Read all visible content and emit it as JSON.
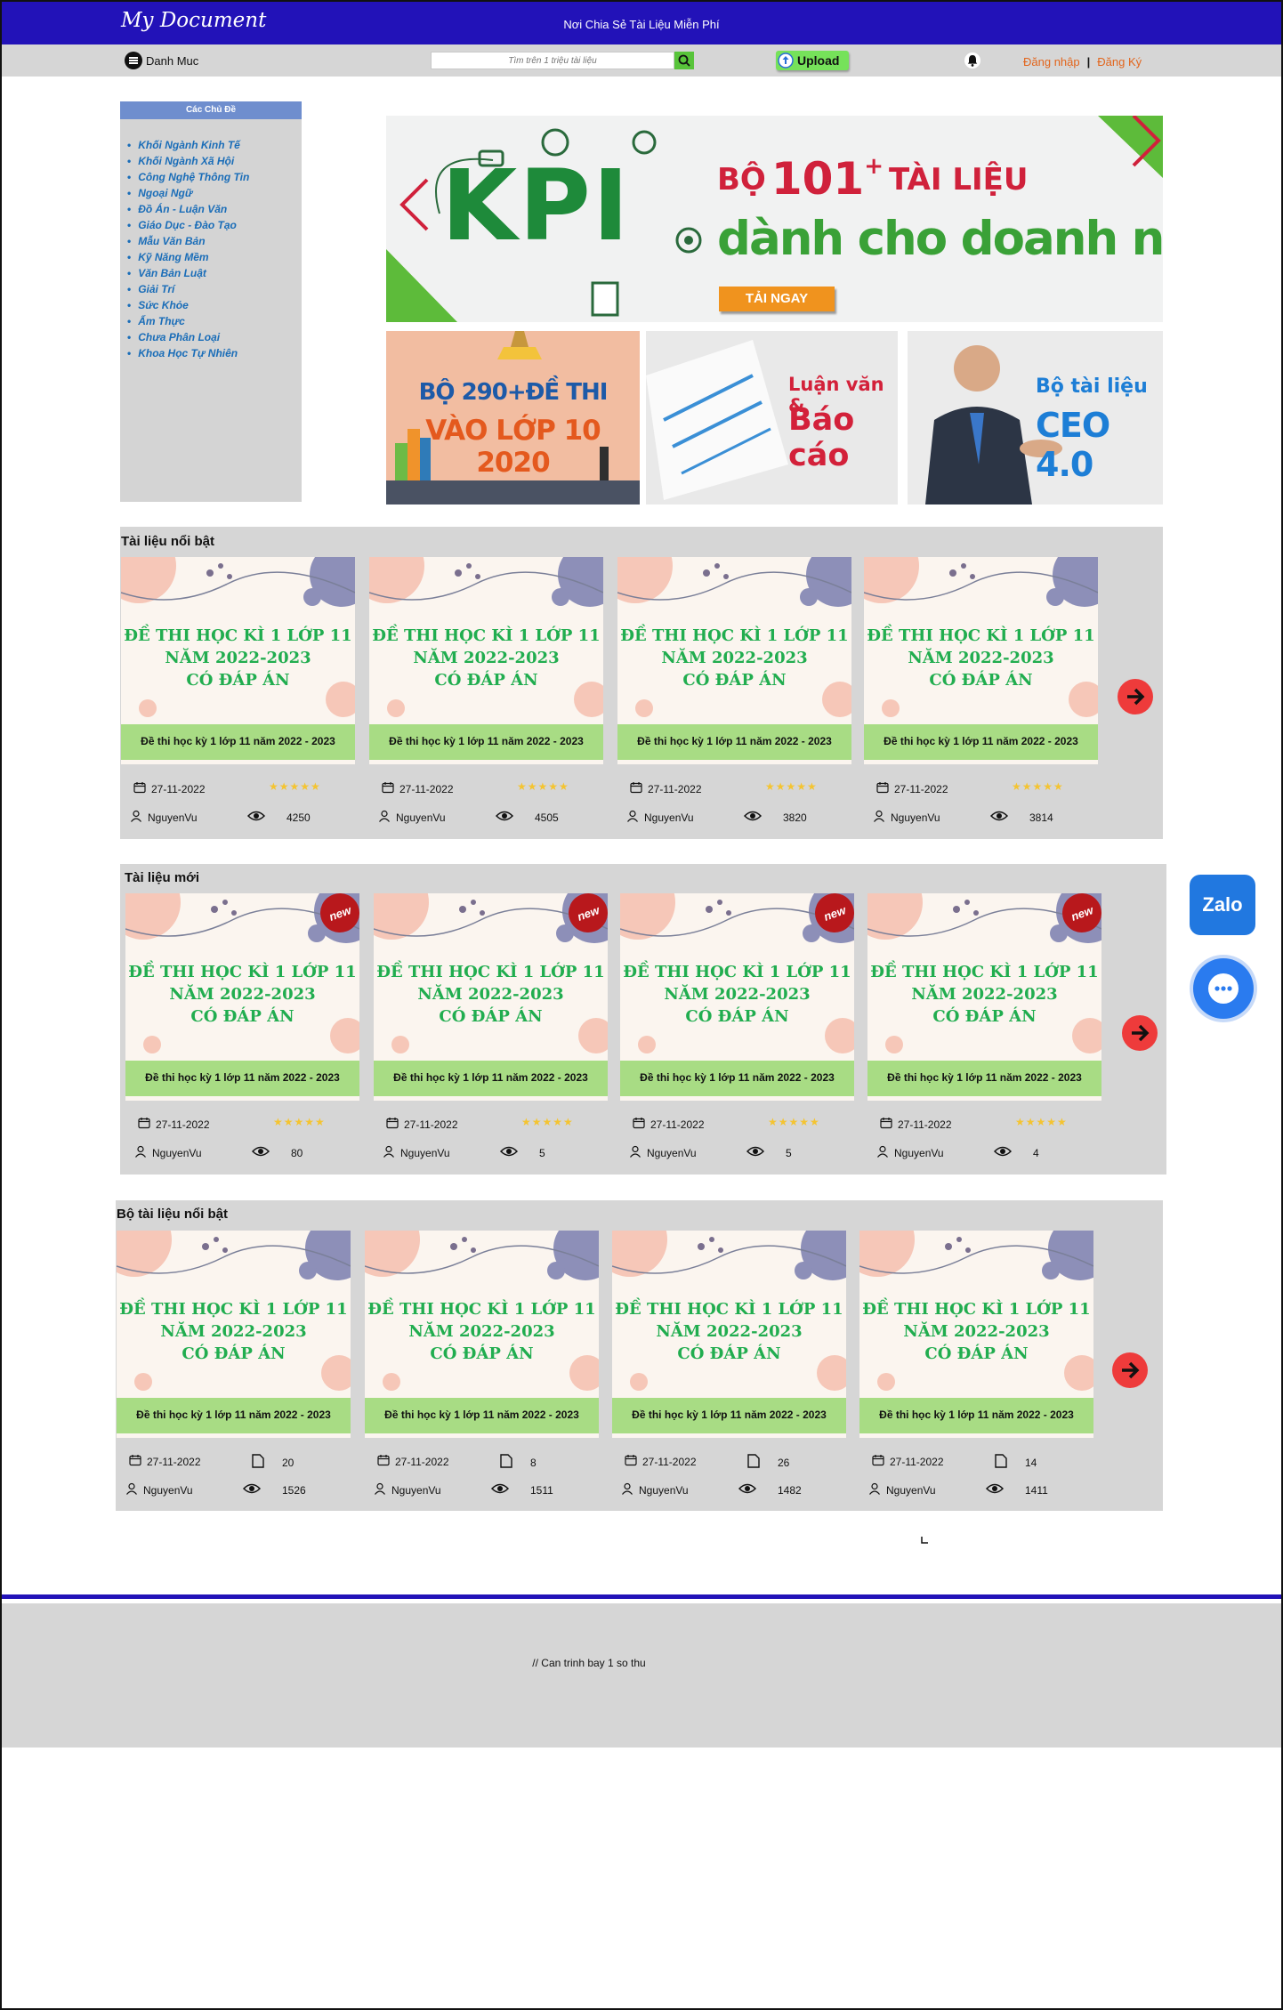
{
  "header": {
    "logo": "My Document",
    "tagline": "Nơi Chia Sẻ Tài Liệu Miễn Phí"
  },
  "navbar": {
    "menu_label": "Danh Muc",
    "search_placeholder": "Tìm trên 1 triệu tài liệu",
    "upload_label": "Upload",
    "login_label": "Đăng nhập",
    "register_label": "Đăng Ký"
  },
  "sidebar": {
    "title": "Các Chủ Đề",
    "items": [
      "Khối Ngành Kinh Tế",
      "Khối Ngành Xã Hội",
      "Công Nghệ Thông Tin",
      "Ngoại Ngữ",
      "Đồ Án - Luận Văn",
      "Giáo Dục - Đào Tạo",
      "Mẫu Văn Bản",
      "Kỹ Năng Mềm",
      "Văn Bản Luật",
      "Giải Trí",
      "Sức Khỏe",
      "Ẩm Thực",
      "Chưa Phân Loại",
      "Khoa Học Tự Nhiên"
    ]
  },
  "banners": {
    "main": {
      "kpi": "KPI",
      "line1_prefix": "BỘ",
      "line1_number": "101",
      "line1_plus": "+",
      "line1_suffix": "TÀI LIỆU",
      "line2": "dành cho doanh nghiệp",
      "button": "TẢI NGAY"
    },
    "sub1": {
      "line1": "BỘ 290+ĐỀ THI",
      "line2": "VÀO LỚP 10 2020"
    },
    "sub2": {
      "line1": "Luận văn &",
      "line2": "Báo cáo"
    },
    "sub3": {
      "line1": "Bộ tài liệu",
      "line2": "CEO 4.0"
    }
  },
  "card_image": {
    "title_line1": "ĐỀ THI HỌC KÌ 1 LỚP 11",
    "title_line2": "NĂM 2022-2023",
    "title_line3": "CÓ ĐÁP ÁN",
    "caption": "Đề thi học kỳ 1 lớp 11 năm 2022 - 2023",
    "new_badge": "new"
  },
  "featured": {
    "title": "Tài liệu nổi bật",
    "cards": [
      {
        "date": "27-11-2022",
        "author": "NguyenVu",
        "views": "4250",
        "rating": 5
      },
      {
        "date": "27-11-2022",
        "author": "NguyenVu",
        "views": "4505",
        "rating": 4.5
      },
      {
        "date": "27-11-2022",
        "author": "NguyenVu",
        "views": "3820",
        "rating": 5
      },
      {
        "date": "27-11-2022",
        "author": "NguyenVu",
        "views": "3814",
        "rating": 5
      }
    ]
  },
  "newest": {
    "title": "Tài liệu mới",
    "cards": [
      {
        "date": "27-11-2022",
        "author": "NguyenVu",
        "views": "80",
        "rating": 5
      },
      {
        "date": "27-11-2022",
        "author": "NguyenVu",
        "views": "5",
        "rating": 4.5
      },
      {
        "date": "27-11-2022",
        "author": "NguyenVu",
        "views": "5",
        "rating": 5
      },
      {
        "date": "27-11-2022",
        "author": "NguyenVu",
        "views": "4",
        "rating": 5
      }
    ]
  },
  "collections": {
    "title": "Bộ tài liệu nổi bật",
    "cards": [
      {
        "date": "27-11-2022",
        "author": "NguyenVu",
        "views": "1526",
        "docs": "20"
      },
      {
        "date": "27-11-2022",
        "author": "NguyenVu",
        "views": "1511",
        "docs": "8"
      },
      {
        "date": "27-11-2022",
        "author": "NguyenVu",
        "views": "1482",
        "docs": "26"
      },
      {
        "date": "27-11-2022",
        "author": "NguyenVu",
        "views": "1411",
        "docs": "14"
      }
    ]
  },
  "widgets": {
    "zalo_label": "Zalo"
  },
  "footer": {
    "note": "// Can trinh bay 1 so thu"
  },
  "colors": {
    "brand": "#2212b8",
    "accent_green": "#21ad4f",
    "arrow_red": "#ee3b3b",
    "link_blue": "#1a6db8",
    "auth_orange": "#e2651c"
  }
}
